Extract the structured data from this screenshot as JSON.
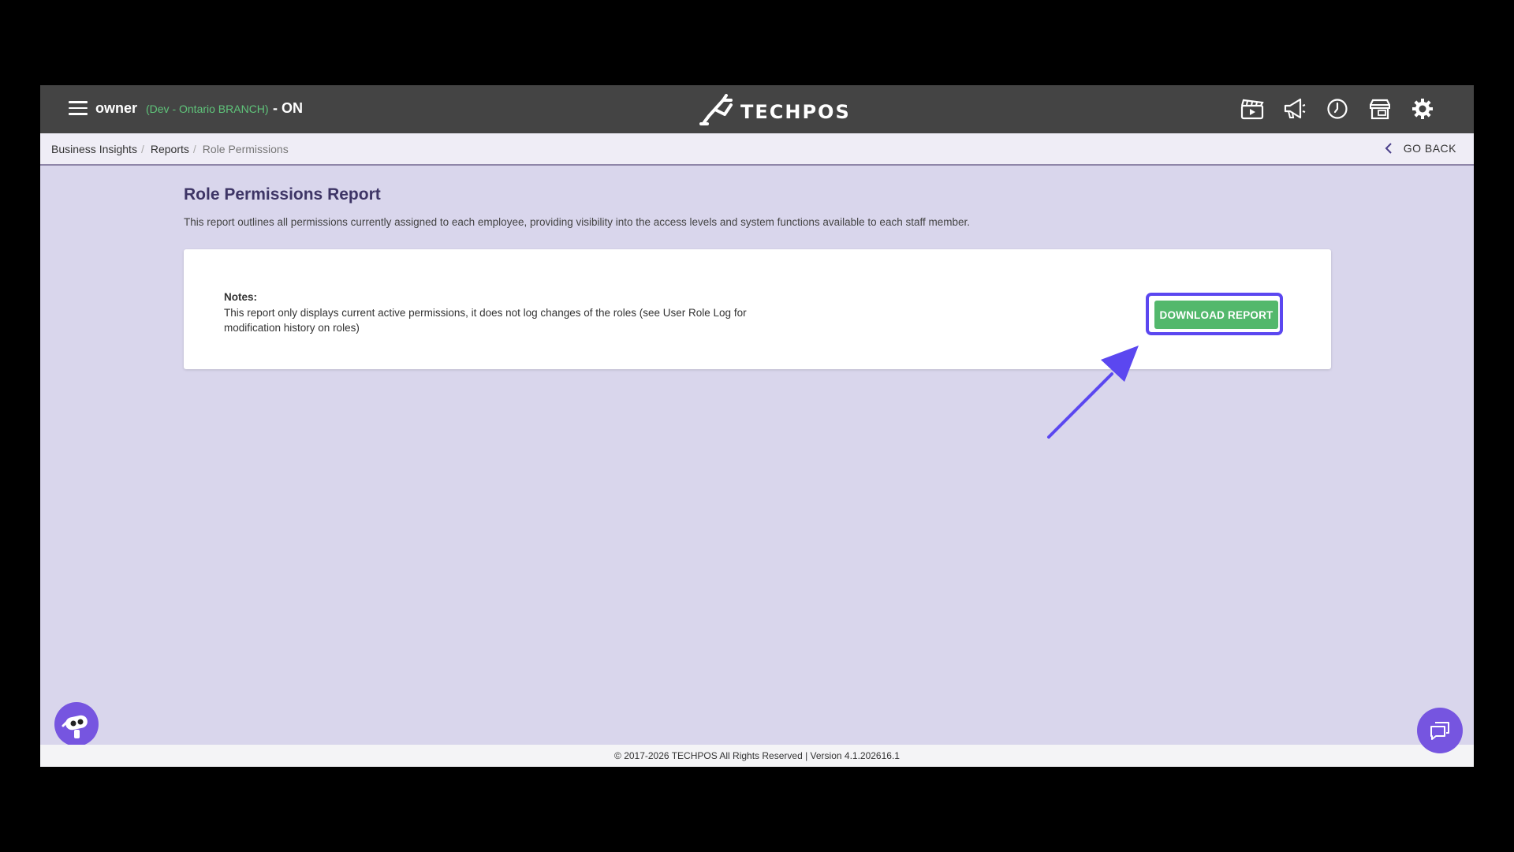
{
  "header": {
    "user": "owner",
    "branch": "(Dev - Ontario BRANCH)",
    "status": "- ON",
    "logo_text": "TECHPOS",
    "icons": [
      "video-clapper-icon",
      "megaphone-icon",
      "clock-icon",
      "store-icon",
      "gear-icon"
    ]
  },
  "breadcrumb": {
    "items": [
      "Business Insights",
      "Reports"
    ],
    "current": "Role Permissions",
    "go_back": "GO BACK"
  },
  "main": {
    "title": "Role Permissions Report",
    "description": "This report outlines all permissions currently assigned to each employee, providing visibility into the access levels and system functions available to each staff member.",
    "notes_label": "Notes:",
    "notes_text": "This report only displays current active permissions, it does not log changes of the roles (see User Role Log for modification history on roles)",
    "download_label": "DOWNLOAD REPORT"
  },
  "footer": {
    "text": "© 2017-2026 TECHPOS All Rights Reserved | Version 4.1.202616.1"
  },
  "colors": {
    "navbar": "#444444",
    "background": "#d9d6ec",
    "accent_green": "#53b86c",
    "highlight": "#5b47f0",
    "title": "#3e3566"
  }
}
